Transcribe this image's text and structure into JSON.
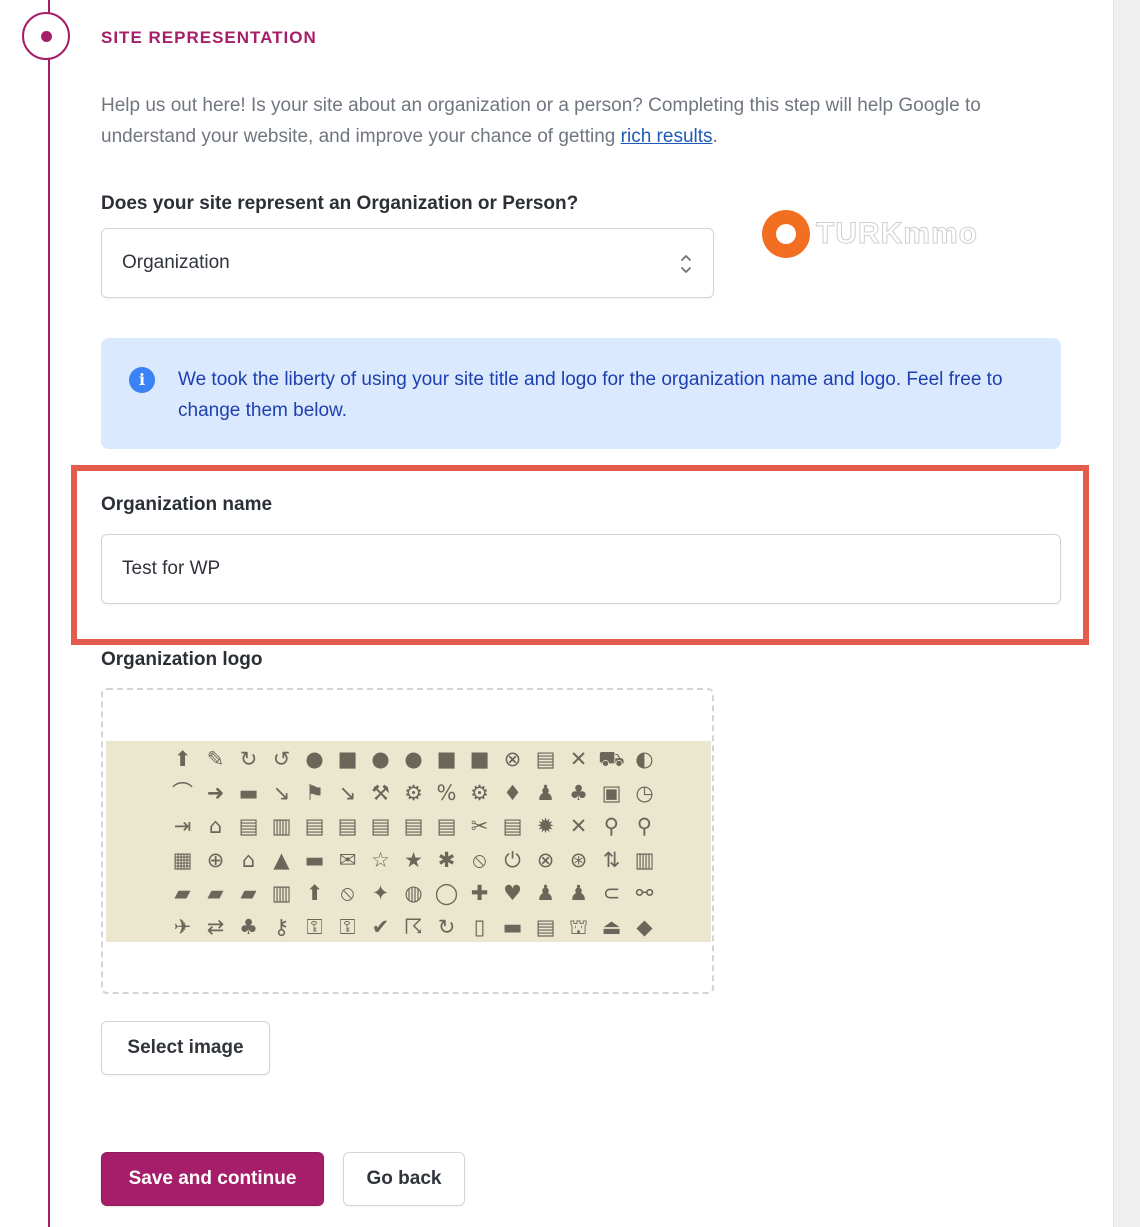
{
  "step": {
    "title": "SITE REPRESENTATION",
    "intro_text": "Help us out here! Is your site about an organization or a person? Completing this step will help Google to understand your website, and improve your chance of getting ",
    "intro_link": "rich results",
    "intro_end": "."
  },
  "represent": {
    "label": "Does your site represent an Organization or Person?",
    "selected": "Organization"
  },
  "notice": {
    "text": "We took the liberty of using your site title and logo for the organization name and logo. Feel free to change them below."
  },
  "org_name": {
    "label": "Organization name",
    "value": "Test for WP"
  },
  "org_logo": {
    "label": "Organization logo",
    "select_button": "Select image"
  },
  "actions": {
    "save": "Save and continue",
    "back": "Go back"
  },
  "watermark": {
    "text": "TURKmmo"
  },
  "colors": {
    "accent": "#a61e69",
    "info_bg": "#dbe9fe",
    "info_text": "#1e40af",
    "highlight": "#e45c4b"
  },
  "logo_icons": [
    "⬆",
    "✎",
    "↻",
    "↺",
    "●",
    "■",
    "●",
    "●",
    "■",
    "■",
    "⊗",
    "▤",
    "✕",
    "⛟",
    "◐",
    "⌒",
    "➜",
    "▬",
    "↘",
    "⚑",
    "↘",
    "⚒",
    "⚙",
    "%",
    "⚙",
    "♦",
    "♟",
    "♣",
    "▣",
    "◷",
    "⇥",
    "⌂",
    "▤",
    "▥",
    "▤",
    "▤",
    "▤",
    "▤",
    "▤",
    "✂",
    "▤",
    "✹",
    "✕",
    "⚲",
    "⚲",
    "▦",
    "⊕",
    "⌂",
    "▲",
    "▬",
    "✉",
    "☆",
    "★",
    "✱",
    "⦸",
    "⏻",
    "⊗",
    "⊛",
    "⇅",
    "▥",
    "▰",
    "▰",
    "▰",
    "▥",
    "⬆",
    "⦸",
    "✦",
    "◍",
    "◯",
    "✚",
    "♥",
    "♟",
    "♟",
    "⊂",
    "⚯",
    "✈",
    "⇄",
    "♣",
    "⚷",
    "⚿",
    "⚿",
    "✔",
    "☈",
    "↻",
    "▯",
    "▬",
    "▤",
    "⛫",
    "⏏",
    "◆"
  ]
}
